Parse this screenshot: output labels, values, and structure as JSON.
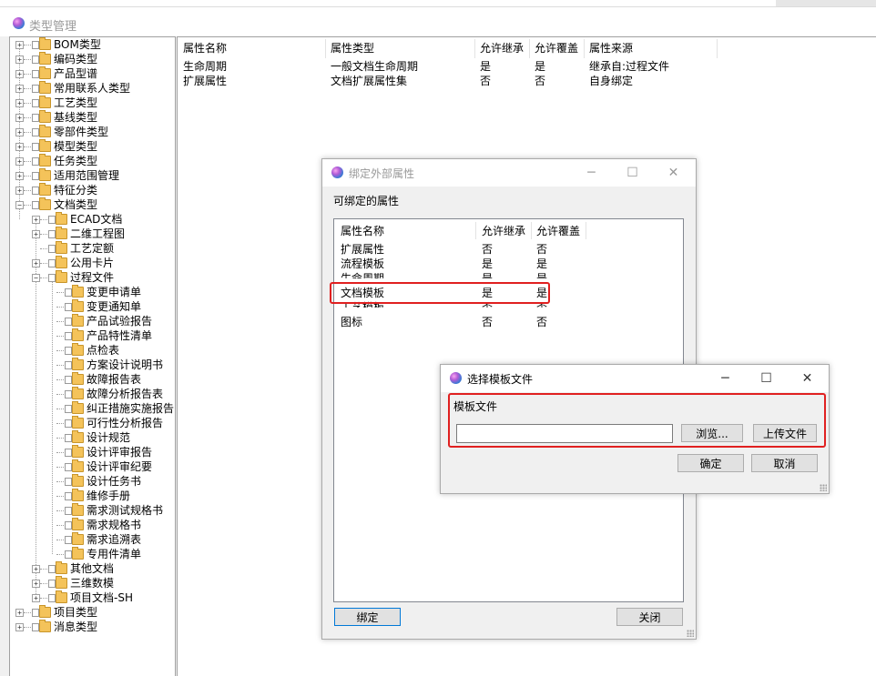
{
  "main_window": {
    "title": "类型管理"
  },
  "tree": {
    "roots": [
      "BOM类型",
      "编码类型",
      "产品型谱",
      "常用联系人类型",
      "工艺类型",
      "基线类型",
      "零部件类型",
      "模型类型",
      "任务类型",
      "适用范围管理",
      "特征分类",
      "文档类型"
    ],
    "doc_children": [
      "ECAD文档",
      "二维工程图",
      "工艺定额",
      "公用卡片",
      "过程文件"
    ],
    "process_children": [
      "变更申请单",
      "变更通知单",
      "产品试验报告",
      "产品特性清单",
      "点检表",
      "方案设计说明书",
      "故障报告表",
      "故障分析报告表",
      "纠正措施实施报告",
      "可行性分析报告",
      "设计规范",
      "设计评审报告",
      "设计评审纪要",
      "设计任务书",
      "维修手册",
      "需求测试规格书",
      "需求规格书",
      "需求追溯表",
      "专用件清单"
    ],
    "doc_children_after": [
      "其他文档",
      "三维数模",
      "项目文档-SH"
    ],
    "roots_after": [
      "项目类型",
      "消息类型"
    ]
  },
  "property_table": {
    "headers": [
      "属性名称",
      "属性类型",
      "允许继承",
      "允许覆盖",
      "属性来源"
    ],
    "rows": [
      [
        "生命周期",
        "一般文档生命周期",
        "是",
        "是",
        "继承自:过程文件"
      ],
      [
        "扩展属性",
        "文档扩展属性集",
        "否",
        "否",
        "自身绑定"
      ]
    ]
  },
  "bind_dialog": {
    "title": "绑定外部属性",
    "section_label": "可绑定的属性",
    "headers": [
      "属性名称",
      "允许继承",
      "允许覆盖"
    ],
    "rows": [
      [
        "扩展属性",
        "否",
        "否"
      ],
      [
        "流程模板",
        "是",
        "是"
      ],
      [
        "生命周期",
        "是",
        "是"
      ],
      [
        "文档模板",
        "是",
        "是"
      ],
      [
        "工艺模板",
        "否",
        "否"
      ],
      [
        "图标",
        "否",
        "否"
      ]
    ],
    "bind_button": "绑定",
    "close_button": "关闭"
  },
  "template_dialog": {
    "title": "选择模板文件",
    "field_label": "模板文件",
    "file_value": "",
    "browse_button": "浏览...",
    "upload_button": "上传文件",
    "ok_button": "确定",
    "cancel_button": "取消"
  },
  "window_controls": {
    "minimize": "─",
    "maximize": "☐",
    "close": "✕"
  },
  "colors": {
    "highlight_border": "#e02020",
    "focus_border": "#0078d7"
  }
}
